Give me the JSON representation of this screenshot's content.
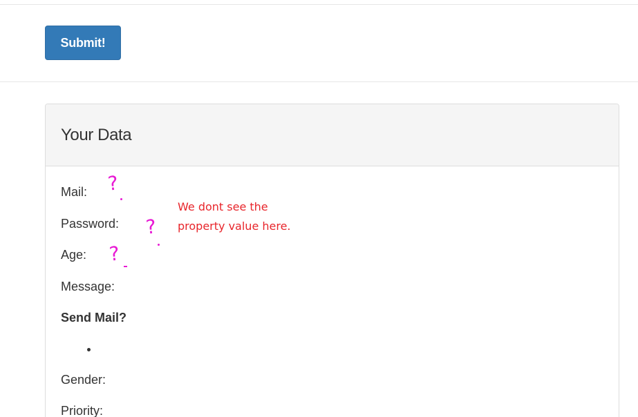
{
  "toolbar": {
    "submit_label": "Submit!"
  },
  "panel": {
    "title": "Your Data",
    "fields": {
      "mail": "Mail:",
      "password": "Password:",
      "age": "Age:",
      "message": "Message:",
      "send_mail": "Send Mail?",
      "gender": "Gender:",
      "priority": "Priority:"
    }
  },
  "annotation": {
    "line1": "We dont see the",
    "line2": "property value here.",
    "mark": "?"
  },
  "colors": {
    "button": "#337ab7",
    "annotation_text": "#e8252b",
    "annotation_mark": "#e81ad4"
  }
}
